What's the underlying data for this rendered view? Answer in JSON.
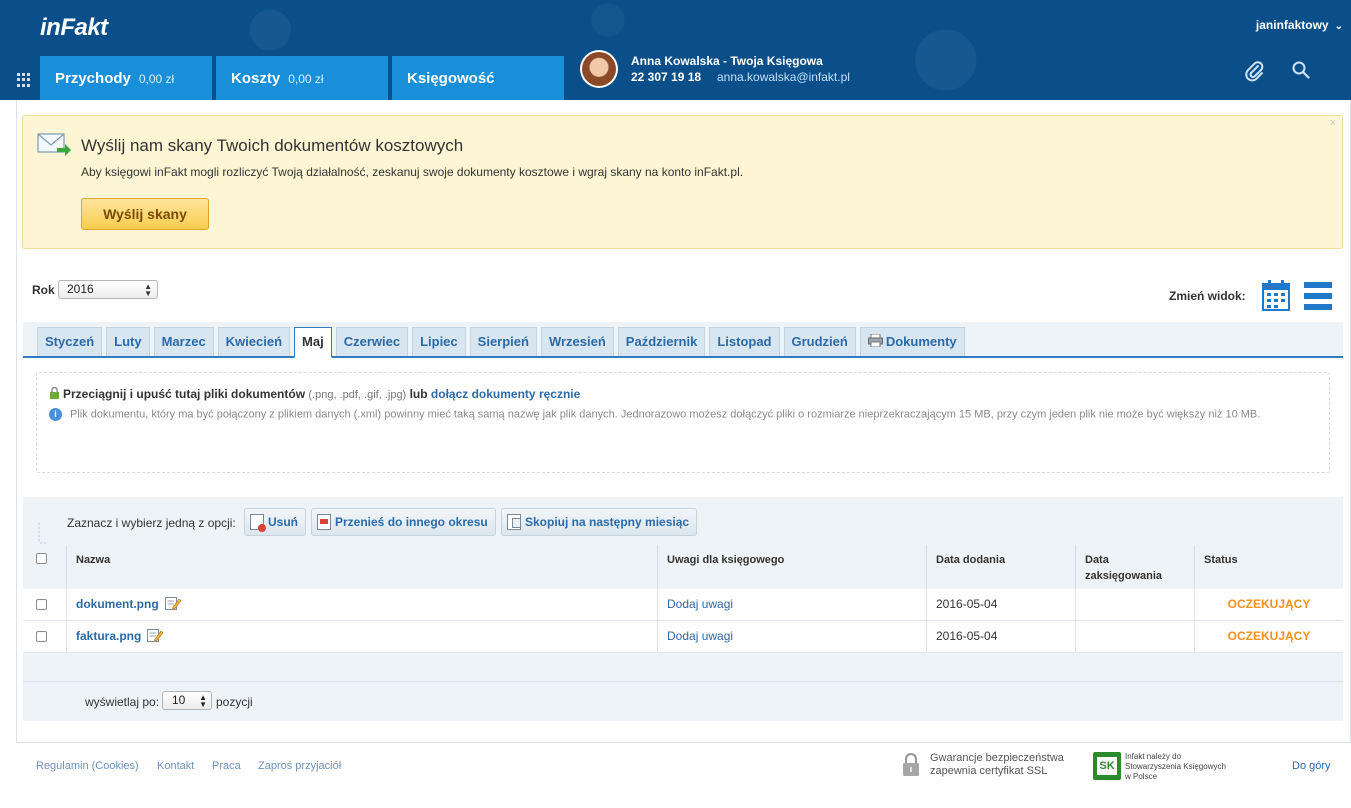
{
  "header": {
    "logo": "inFakt",
    "username": "janinfaktowy",
    "nav": [
      {
        "label": "Przychody",
        "amount": "0,00 zł"
      },
      {
        "label": "Koszty",
        "amount": "0,00 zł"
      },
      {
        "label": "Księgowość"
      }
    ],
    "accountant": {
      "name": "Anna Kowalska - Twoja Księgowa",
      "phone": "22 307 19 18",
      "email": "anna.kowalska@infakt.pl"
    }
  },
  "notice": {
    "title": "Wyślij nam skany Twoich dokumentów kosztowych",
    "text": "Aby księgowi inFakt mogli rozliczyć Twoją działalność, zeskanuj swoje dokumenty kosztowe i wgraj skany na konto inFakt.pl.",
    "button": "Wyślij skany",
    "close": "×"
  },
  "year": {
    "label": "Rok",
    "value": "2016"
  },
  "view": {
    "label": "Zmień widok:"
  },
  "tabs": [
    "Styczeń",
    "Luty",
    "Marzec",
    "Kwiecień",
    "Maj",
    "Czerwiec",
    "Lipiec",
    "Sierpień",
    "Wrzesień",
    "Październik",
    "Listopad",
    "Grudzień",
    "Dokumenty"
  ],
  "active_tab": "Maj",
  "dropzone": {
    "main": "Przeciągnij i upuść tutaj pliki dokumentów",
    "extensions": "(.png, .pdf, .gif, .jpg)",
    "or": "lub",
    "link": "dołącz dokumenty ręcznie",
    "info": "Plik dokumentu, który ma być połączony z plikiem danych (.xml) powinny mieć taką samą nazwę jak plik danych. Jednorazowo możesz dołączyć pliki o rozmiarze nieprzekraczającym 15 MB, przy czym jeden plik nie może być większy niż 10 MB."
  },
  "actions": {
    "label": "Zaznacz i wybierz jedną z opcji:",
    "delete": "Usuń",
    "move": "Przenieś do innego okresu",
    "copy": "Skopiuj na następny miesiąc"
  },
  "table": {
    "headers": [
      "Nazwa",
      "Uwagi dla księgowego",
      "Data dodania",
      "Data zaksięgowania",
      "Status"
    ],
    "rows": [
      {
        "name": "dokument.png",
        "notes": "Dodaj uwagi",
        "added": "2016-05-04",
        "booked": "",
        "status": "OCZEKUJĄCY"
      },
      {
        "name": "faktura.png",
        "notes": "Dodaj uwagi",
        "added": "2016-05-04",
        "booked": "",
        "status": "OCZEKUJĄCY"
      }
    ]
  },
  "pagination": {
    "label": "wyświetlaj po:",
    "value": "10",
    "suffix": "pozycji"
  },
  "footer": {
    "links": [
      "Regulamin (Cookies)",
      "Kontakt",
      "Praca",
      "Zaproś przyjaciół"
    ],
    "ssl": [
      "Gwarancje bezpieczeństwa",
      "zapewnia certyfikat SSL"
    ],
    "ski": [
      "Infakt należy do",
      "Stowarzyszenia Księgowych",
      "w Polsce"
    ],
    "ski_logo": "SK",
    "to_top": "Do góry"
  },
  "colors": {
    "brand": "#0b4f8a",
    "tab_blue": "#1a8fd9",
    "status_pending": "#f39020",
    "link": "#2b6aa8"
  }
}
